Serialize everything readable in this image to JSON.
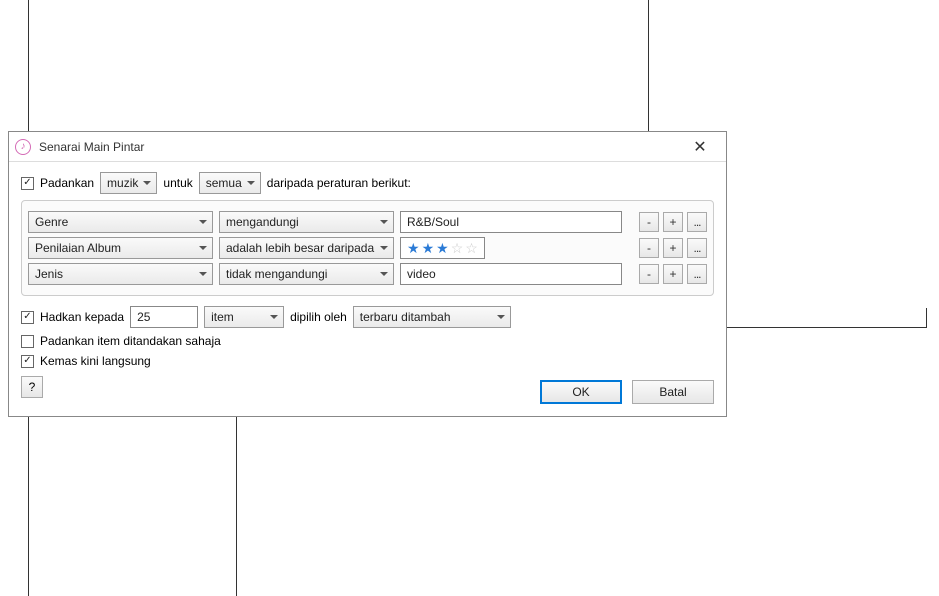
{
  "dialog": {
    "title": "Senarai Main Pintar",
    "match_label_prefix": "Padankan",
    "match_type": "muzik",
    "match_conj": "untuk",
    "match_scope": "semua",
    "match_suffix": "daripada peraturan berikut:"
  },
  "rules": [
    {
      "field": "Genre",
      "op": "mengandungi",
      "value": "R&B/Soul",
      "value_type": "text"
    },
    {
      "field": "Penilaian Album",
      "op": "adalah lebih besar daripada",
      "value_type": "stars",
      "stars_filled": 3,
      "stars_total": 5
    },
    {
      "field": "Jenis",
      "op": "tidak mengandungi",
      "value": "video",
      "value_type": "text"
    }
  ],
  "row_buttons": {
    "remove": "-",
    "add": "+",
    "more": "..."
  },
  "options": {
    "limit_checked": true,
    "limit_label": "Hadkan kepada",
    "limit_value": "25",
    "limit_unit": "item",
    "limit_by_label": "dipilih oleh",
    "limit_by_value": "terbaru ditambah",
    "match_checked_only_checked": false,
    "match_checked_only_label": "Padankan item ditandakan sahaja",
    "live_update_checked": true,
    "live_update_label": "Kemas kini langsung"
  },
  "footer": {
    "help": "?",
    "ok": "OK",
    "cancel": "Batal"
  }
}
